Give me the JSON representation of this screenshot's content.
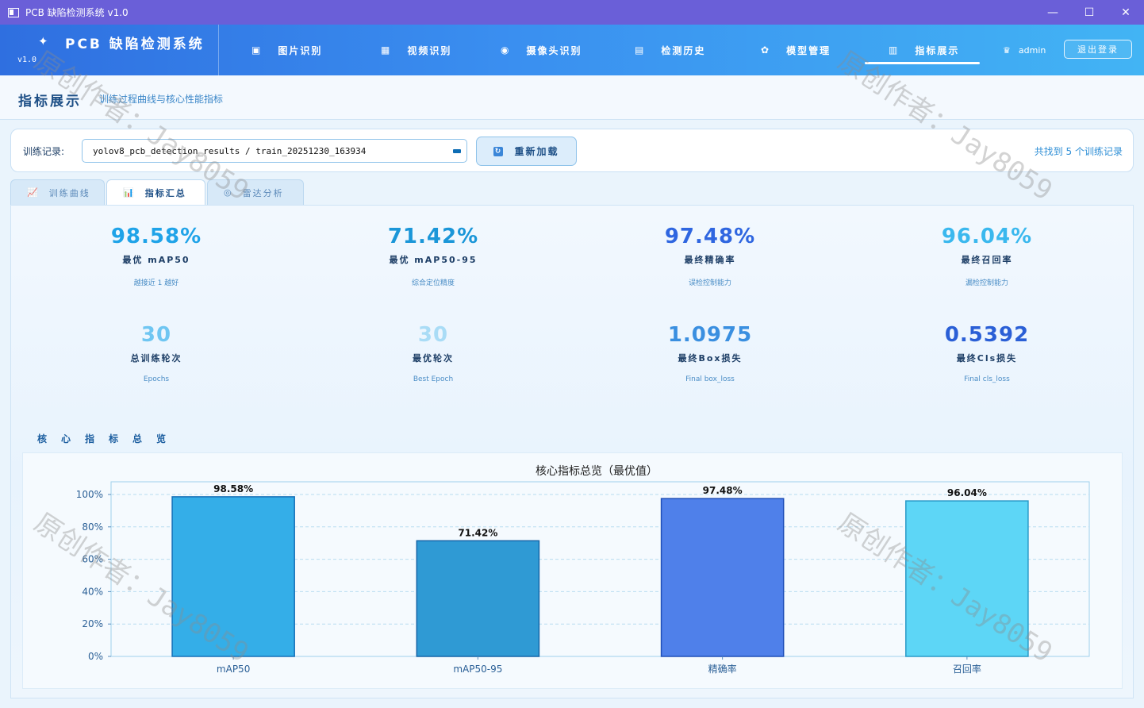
{
  "window": {
    "title": "PCB 缺陷检测系统 v1.0",
    "minimize": "—",
    "maximize": "☐",
    "close": "✕"
  },
  "brand": {
    "name": "PCB 缺陷检测系统",
    "version": "v1.0"
  },
  "nav": {
    "items": [
      {
        "label": "图片识别",
        "icon": "image-icon"
      },
      {
        "label": "视频识别",
        "icon": "video-icon"
      },
      {
        "label": "摄像头识别",
        "icon": "camera-icon"
      },
      {
        "label": "检测历史",
        "icon": "history-icon"
      },
      {
        "label": "模型管理",
        "icon": "gear-icon"
      },
      {
        "label": "指标展示",
        "icon": "metrics-icon"
      }
    ],
    "user": "admin",
    "logout": "退出登录"
  },
  "page": {
    "title": "指标展示",
    "subtitle": "训练过程曲线与核心性能指标"
  },
  "record": {
    "label": "训练记录:",
    "selected": "yolov8_pcb_detection_results / train_20251230_163934",
    "reload": "重新加载",
    "count": "共找到 5 个训练记录"
  },
  "tabs": [
    {
      "label": "训练曲线",
      "icon": "line-chart-icon"
    },
    {
      "label": "指标汇总",
      "icon": "bar-chart-icon"
    },
    {
      "label": "雷达分析",
      "icon": "target-icon"
    }
  ],
  "metrics": [
    {
      "value": "98.58%",
      "label": "最优 mAP50",
      "desc": "越接近 1 越好",
      "color": "#1fa3e8"
    },
    {
      "value": "71.42%",
      "label": "最优 mAP50-95",
      "desc": "综合定位精度",
      "color": "#1a96d8"
    },
    {
      "value": "97.48%",
      "label": "最终精确率",
      "desc": "误检控制能力",
      "color": "#2f66e0"
    },
    {
      "value": "96.04%",
      "label": "最终召回率",
      "desc": "漏检控制能力",
      "color": "#3ab8ee"
    },
    {
      "value": "30",
      "label": "总训练轮次",
      "desc": "Epochs",
      "color": "#6fc6f2"
    },
    {
      "value": "30",
      "label": "最优轮次",
      "desc": "Best Epoch",
      "color": "#a9dcf6"
    },
    {
      "value": "1.0975",
      "label": "最终Box损失",
      "desc": "Final box_loss",
      "color": "#3a8fe0"
    },
    {
      "value": "0.5392",
      "label": "最终Cls损失",
      "desc": "Final cls_loss",
      "color": "#2a5fd6"
    }
  ],
  "section_title": "核心指标总览",
  "watermark": "原创作者：Jay8059",
  "chart_data": {
    "type": "bar",
    "title": "核心指标总览（最优值）",
    "categories": [
      "mAP50",
      "mAP50-95",
      "精确率",
      "召回率"
    ],
    "values": [
      98.58,
      71.42,
      97.48,
      96.04
    ],
    "data_labels": [
      "98.58%",
      "71.42%",
      "97.48%",
      "96.04%"
    ],
    "colors": [
      "#34aee8",
      "#2f9ad4",
      "#4f80ea",
      "#5dd6f6"
    ],
    "edge_colors": [
      "#1570b8",
      "#1565a8",
      "#1f4fb8",
      "#2a9ac8"
    ],
    "ylim": [
      0,
      100
    ],
    "yticks": [
      "0%",
      "20%",
      "40%",
      "60%",
      "80%",
      "100%"
    ],
    "grid": true
  }
}
